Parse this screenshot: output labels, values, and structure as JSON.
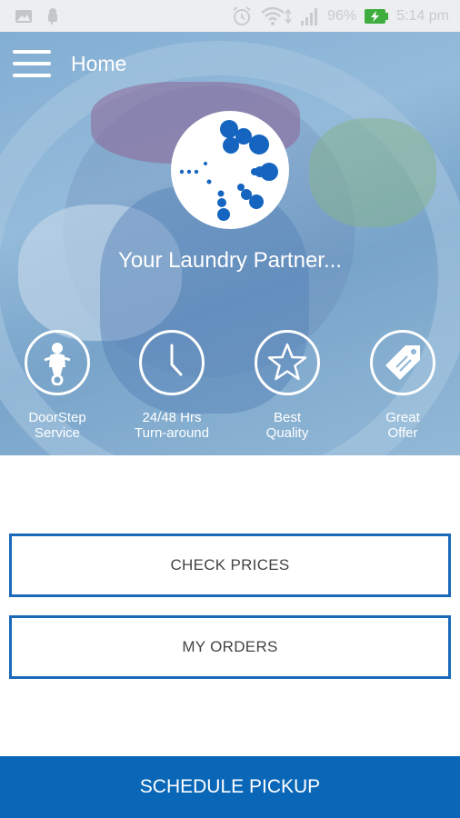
{
  "status_bar": {
    "battery_percent": "96%",
    "time": "5:14 pm",
    "icons": [
      "image-icon",
      "android-icon",
      "alarm-icon",
      "wifi-icon",
      "signal-icon",
      "battery-charging-icon"
    ]
  },
  "header": {
    "title": "Home",
    "menu_icon": "hamburger-menu-icon"
  },
  "hero": {
    "logo_icon": "laundry-swirl-logo",
    "tagline": "Your Laundry Partner..."
  },
  "features": [
    {
      "icon": "scooter-rider-icon",
      "label": "DoorStep\nService"
    },
    {
      "icon": "clock-icon",
      "label": "24/48 Hrs\nTurn-around"
    },
    {
      "icon": "star-icon",
      "label": "Best\nQuality"
    },
    {
      "icon": "price-tag-icon",
      "label": "Great\nOffer"
    }
  ],
  "actions": {
    "check_prices": "CHECK PRICES",
    "my_orders": "MY ORDERS",
    "schedule_pickup": "SCHEDULE PICKUP"
  },
  "colors": {
    "primary": "#0a67b8",
    "button_border": "#1b6aba",
    "status_bar_bg": "#eceeef"
  }
}
